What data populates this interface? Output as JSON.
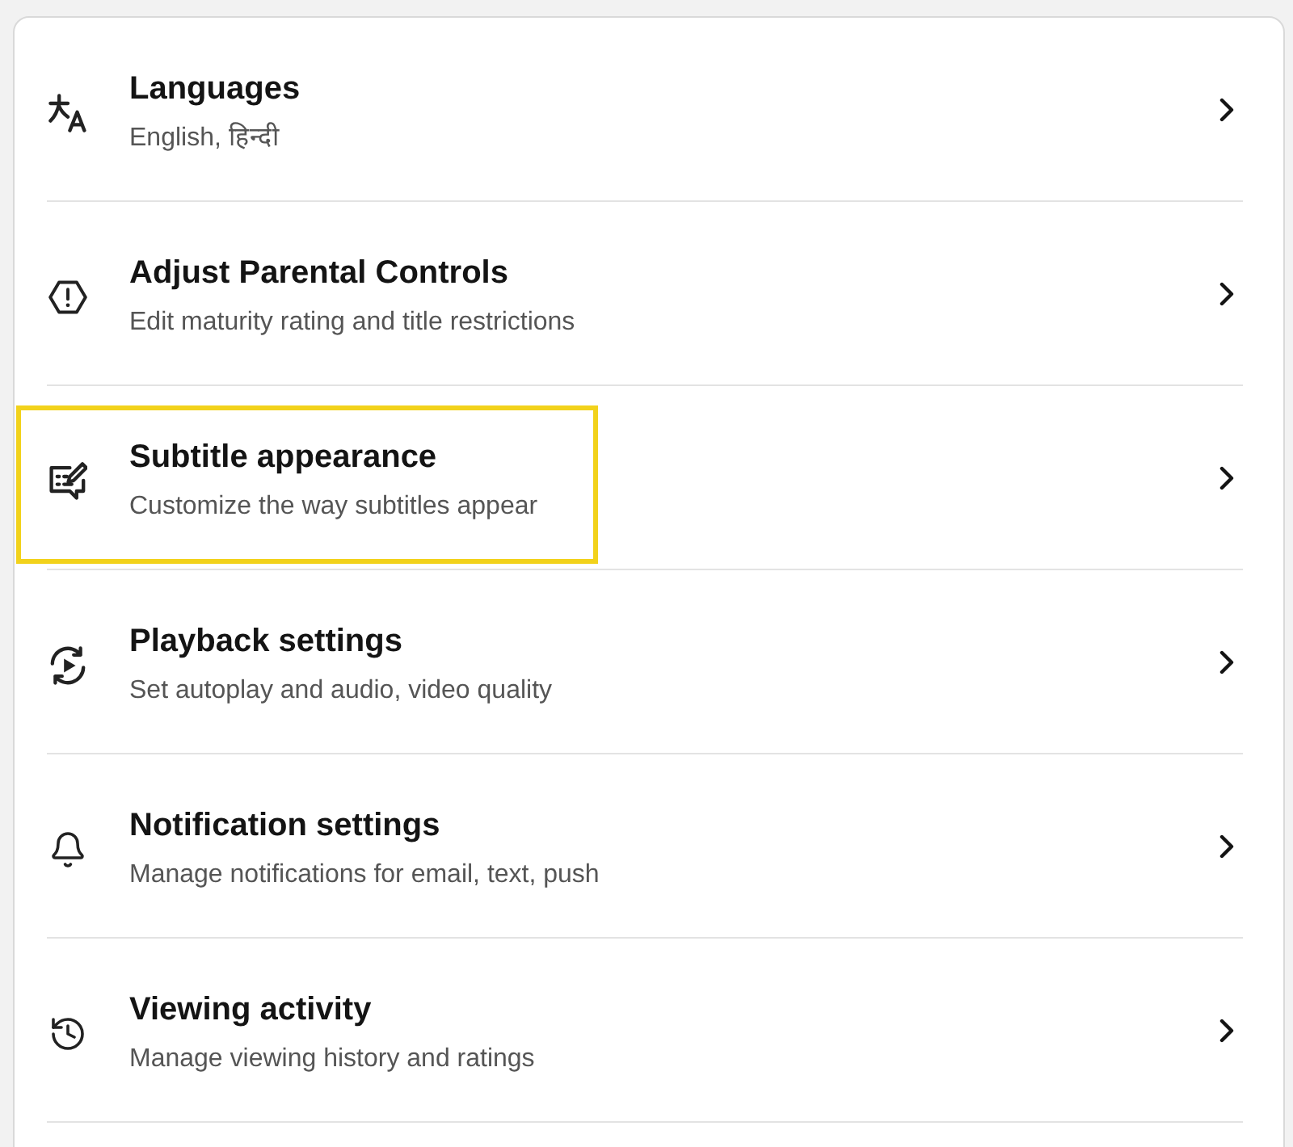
{
  "items": [
    {
      "title": "Languages",
      "subtitle": "English, हिन्दी",
      "highlighted": false
    },
    {
      "title": "Adjust Parental Controls",
      "subtitle": "Edit maturity rating and title restrictions",
      "highlighted": false
    },
    {
      "title": "Subtitle appearance",
      "subtitle": "Customize the way subtitles appear",
      "highlighted": true
    },
    {
      "title": "Playback settings",
      "subtitle": "Set autoplay and audio, video quality",
      "highlighted": false
    },
    {
      "title": "Notification settings",
      "subtitle": "Manage notifications for email, text, push",
      "highlighted": false
    },
    {
      "title": "Viewing activity",
      "subtitle": "Manage viewing history and ratings",
      "highlighted": false
    }
  ]
}
